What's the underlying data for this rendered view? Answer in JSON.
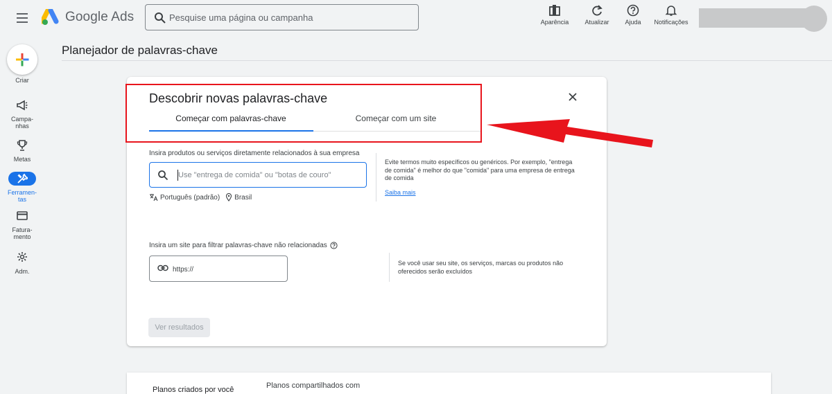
{
  "app": {
    "brand": "Google Ads"
  },
  "search": {
    "placeholder": "Pesquise uma página ou campanha"
  },
  "header_tools": [
    {
      "label": "Aparência",
      "icon": "appearance-icon"
    },
    {
      "label": "Atualizar",
      "icon": "refresh-icon"
    },
    {
      "label": "Ajuda",
      "icon": "help-icon"
    },
    {
      "label": "Notificações",
      "icon": "bell-icon"
    }
  ],
  "nav": {
    "create": "Criar",
    "campaigns": "Campa-\nnhas",
    "goals": "Metas",
    "tools": "Ferramen-\ntas",
    "billing": "Fatura-\nmento",
    "admin": "Adm."
  },
  "page": {
    "title": "Planejador de palavras-chave"
  },
  "card": {
    "title": "Descobrir novas palavras-chave",
    "tabs": [
      "Começar com palavras-chave",
      "Começar com um site"
    ],
    "keywords_label": "Insira produtos ou serviços diretamente relacionados à sua empresa",
    "keywords_placeholder": "Use \"entrega de comida\" ou \"botas de couro\"",
    "language": "Português (padrão)",
    "location": "Brasil",
    "tip1": "Evite termos muito específicos ou genéricos. Por exemplo, \"entrega de comida\" é melhor do que \"comida\" para uma empresa de entrega de comida",
    "learn_more": "Saiba mais",
    "site_label": "Insira um site para filtrar palavras-chave não relacionadas",
    "site_placeholder": "https://",
    "tip2": "Se você usar seu site, os serviços, marcas ou produtos não oferecidos serão excluídos",
    "results_button": "Ver resultados"
  },
  "bottom": {
    "tabs": [
      "Planos criados por você",
      "Planos compartilhados com"
    ]
  },
  "colors": {
    "accent": "#1a73e8",
    "annotation": "#e8141c"
  }
}
